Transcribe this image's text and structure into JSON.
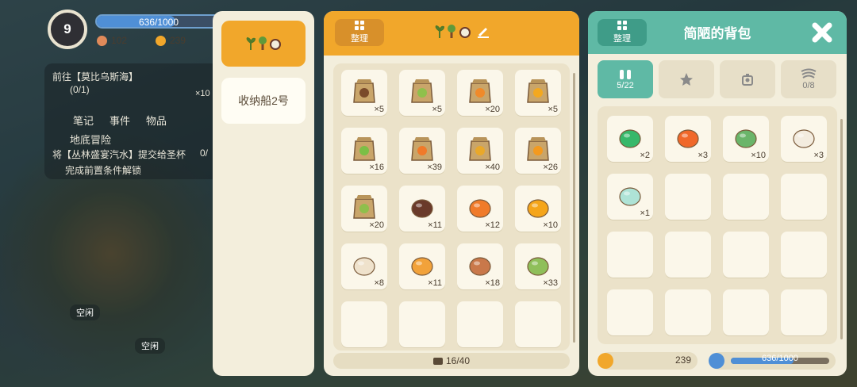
{
  "hud": {
    "level": "9",
    "exp_text": "636/1000",
    "exp_fraction": 0.636,
    "currency_a": "102",
    "currency_b": "239"
  },
  "quest": {
    "target": "前往【莫比乌斯海】",
    "progress": "(0/1)",
    "reward_qty": "×10",
    "tabs": [
      "笔记",
      "事件",
      "物品"
    ],
    "section": "地底冒险",
    "task": "将【丛林盛宴汽水】提交给圣杯",
    "task_count": "0/",
    "locked": "完成前置条件解锁"
  },
  "world": {
    "idle_1": "空闲",
    "idle_2": "空闲"
  },
  "storage_list": {
    "items": [
      {
        "label": "",
        "icons": [
          "sprout-icon",
          "tree-icon",
          "coconut-icon"
        ],
        "active": true
      },
      {
        "label": "收纳船2号",
        "active": false
      }
    ]
  },
  "storage": {
    "sort_label": "整理",
    "capacity": "16/40",
    "slots": [
      {
        "name": "coffee-bean-sack",
        "qty": "×5",
        "color": "#7a4a2a"
      },
      {
        "name": "seed-bag-green",
        "qty": "×5",
        "color": "#8fc04c"
      },
      {
        "name": "seed-bag-orange",
        "qty": "×20",
        "color": "#f08a2a"
      },
      {
        "name": "seed-bag-yellow",
        "qty": "×5",
        "color": "#f3a81f"
      },
      {
        "name": "seed-bag-leaf",
        "qty": "×16",
        "color": "#7bbf46"
      },
      {
        "name": "seed-bag-carrot",
        "qty": "×39",
        "color": "#f07a2a"
      },
      {
        "name": "seed-bag-gold",
        "qty": "×40",
        "color": "#e9a82a"
      },
      {
        "name": "seed-bag-pumpkin",
        "qty": "×26",
        "color": "#f39a1f"
      },
      {
        "name": "seed-bag-sprout",
        "qty": "×20",
        "color": "#8fbf4c"
      },
      {
        "name": "coconut",
        "qty": "×11",
        "color": "#6a3a2a"
      },
      {
        "name": "carrot",
        "qty": "×12",
        "color": "#f07b2a"
      },
      {
        "name": "orange-fruit",
        "qty": "×10",
        "color": "#f5a51a"
      },
      {
        "name": "flour-block",
        "qty": "×8",
        "color": "#efe2cc"
      },
      {
        "name": "honey-jar",
        "qty": "×11",
        "color": "#f2a23a"
      },
      {
        "name": "bread-loaf",
        "qty": "×18",
        "color": "#c9784a"
      },
      {
        "name": "green-pot",
        "qty": "×33",
        "color": "#8fbf5a"
      },
      {
        "name": "",
        "qty": ""
      },
      {
        "name": "",
        "qty": ""
      },
      {
        "name": "",
        "qty": ""
      },
      {
        "name": "",
        "qty": ""
      }
    ]
  },
  "bag": {
    "title": "简陋的背包",
    "sort_label": "整理",
    "tabs": [
      {
        "icon": "backpack-icon",
        "label": "5/22",
        "active": true
      },
      {
        "icon": "star-icon",
        "label": "",
        "active": false
      },
      {
        "icon": "scale-icon",
        "label": "",
        "active": false
      },
      {
        "icon": "wind-icon",
        "label": "0/8",
        "active": false
      }
    ],
    "slots": [
      {
        "name": "green-slime",
        "qty": "×2",
        "color": "#37b86a"
      },
      {
        "name": "orange-potion",
        "qty": "×3",
        "color": "#f0682a"
      },
      {
        "name": "moss-rock",
        "qty": "×10",
        "color": "#6ab56a"
      },
      {
        "name": "cream-dessert",
        "qty": "×3",
        "color": "#f3ecdf"
      },
      {
        "name": "jungle-soda",
        "qty": "×1",
        "color": "#aee3d6"
      },
      {
        "name": "",
        "qty": ""
      },
      {
        "name": "",
        "qty": ""
      },
      {
        "name": "",
        "qty": ""
      },
      {
        "name": "",
        "qty": ""
      },
      {
        "name": "",
        "qty": ""
      },
      {
        "name": "",
        "qty": ""
      },
      {
        "name": "",
        "qty": ""
      },
      {
        "name": "",
        "qty": ""
      },
      {
        "name": "",
        "qty": ""
      },
      {
        "name": "",
        "qty": ""
      },
      {
        "name": "",
        "qty": ""
      }
    ],
    "gold": "239",
    "stamina_text": "636/1000",
    "stamina_fraction": 0.636
  },
  "colors": {
    "orange_accent": "#f1a72b",
    "teal_accent": "#5fb9a5",
    "panel_bg": "#f3eedc",
    "slot_bg": "#fbf7ea"
  }
}
